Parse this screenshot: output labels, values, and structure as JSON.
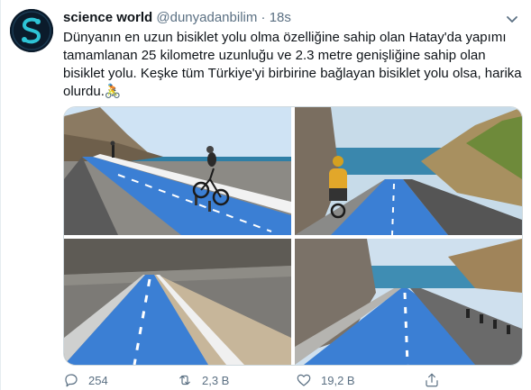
{
  "tweet": {
    "display_name": "science world",
    "handle": "@dunyadanbilim",
    "separator": "·",
    "time": "18s",
    "text": "Dünyanın en uzun bisiklet yolu olma özelliğine sahip olan Hatay'da yapımı tamamlanan 25 kilometre uzunluğu ve 2.3 metre genişliğine sahip olan bisiklet yolu. Keşke tüm Türkiye'yi birbirine bağlayan bisiklet yolu olsa, harika olurdu.",
    "emoji": "🚴"
  },
  "icons": {
    "avatar": "science-world-logo",
    "more": "chevron-down-icon",
    "reply": "reply-icon",
    "retweet": "retweet-icon",
    "like": "heart-icon",
    "share": "share-icon"
  },
  "stats": {
    "replies": "254",
    "retweets": "2,3 B",
    "likes": "19,2 B"
  },
  "colors": {
    "bike_lane": "#3b7fd4",
    "sky": "#c5dff4",
    "sea": "#2f7fa6",
    "muted": "#5b7083"
  }
}
